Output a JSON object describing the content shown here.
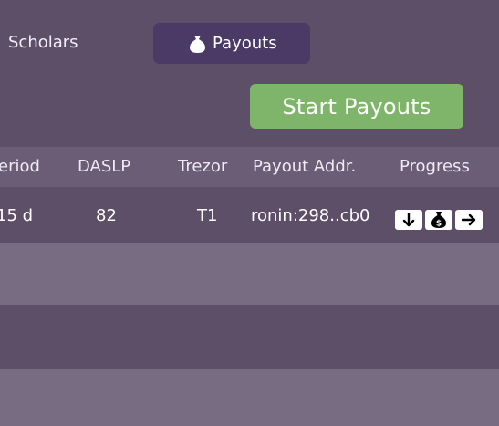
{
  "nav": {
    "scholars_label": "Scholars",
    "payouts_label": "Payouts",
    "payouts_icon": "money-bag-icon"
  },
  "actions": {
    "start_payouts_label": "Start Payouts"
  },
  "table": {
    "headers": [
      "eriod",
      "DASLP",
      "Trezor",
      "Payout Addr.",
      "Progress"
    ],
    "rows": [
      {
        "period": "15 d",
        "daslp": "82",
        "trezor": "T1",
        "payout_addr": "ronin:298..cb0",
        "progress_icons": [
          "arrow-down-icon",
          "money-bag-icon",
          "arrow-right-icon"
        ]
      }
    ]
  },
  "colors": {
    "background": "#5e4f69",
    "active_tab": "#4a3a65",
    "start_button": "#7fb56a",
    "header_row": "#6b5d76",
    "alt_row": "#786c83"
  }
}
